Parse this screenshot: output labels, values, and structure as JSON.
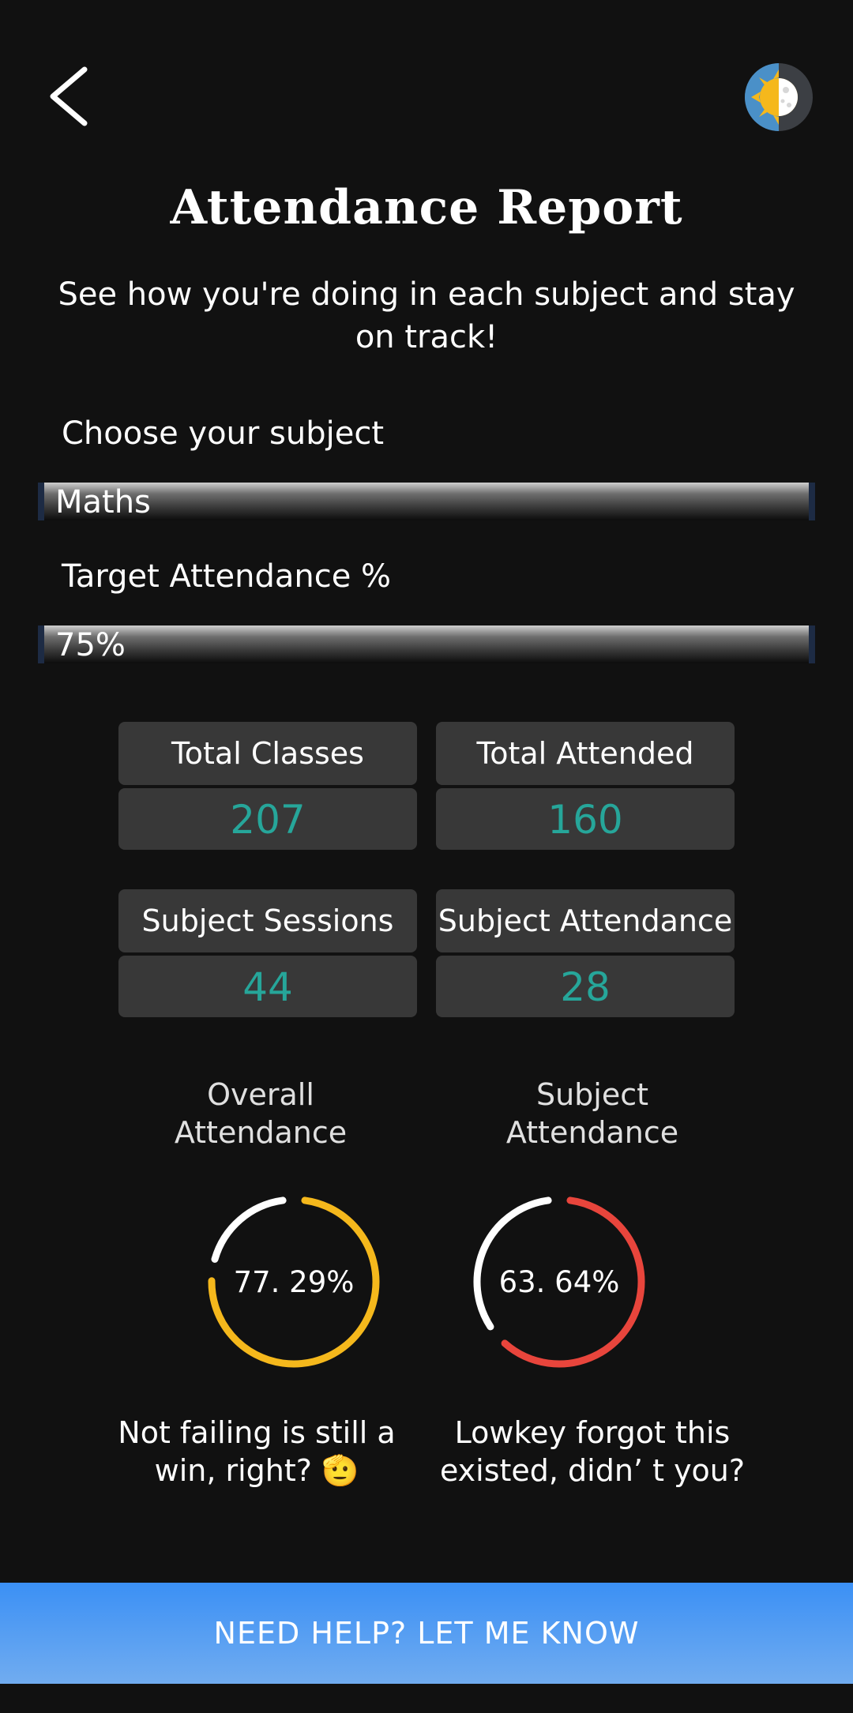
{
  "header": {
    "title": "Attendance Report",
    "subtitle": "See how you're doing in each subject and stay on track!"
  },
  "subject_select": {
    "label": "Choose your subject",
    "value": "Maths"
  },
  "target_select": {
    "label": "Target Attendance %",
    "value": "75%"
  },
  "stats": {
    "total_classes": {
      "label": "Total Classes",
      "value": "207"
    },
    "total_attended": {
      "label": "Total Attended",
      "value": "160"
    },
    "subject_sessions": {
      "label": "Subject Sessions",
      "value": "44"
    },
    "subject_attendance": {
      "label": "Subject Attendance",
      "value": "28"
    }
  },
  "rings": {
    "overall": {
      "label": "Overall Attendance",
      "percent_text": "77. 29%",
      "percent": 77.29,
      "color": "#f5b81c",
      "message": "Not failing is still a win,  right?  🫡"
    },
    "subject": {
      "label": "Subject Attendance",
      "percent_text": "63. 64%",
      "percent": 63.64,
      "color": "#e8453c",
      "message": "Lowkey forgot this existed,  didn’ t you?"
    }
  },
  "help_button": {
    "label": "NEED HELP?  LET ME KNOW"
  },
  "icons": {
    "back": "chevron-left-icon",
    "theme": "sun-moon-icon"
  },
  "colors": {
    "accent_teal": "#26a69a",
    "help_blue": "#3b90f5",
    "background": "#111111"
  }
}
